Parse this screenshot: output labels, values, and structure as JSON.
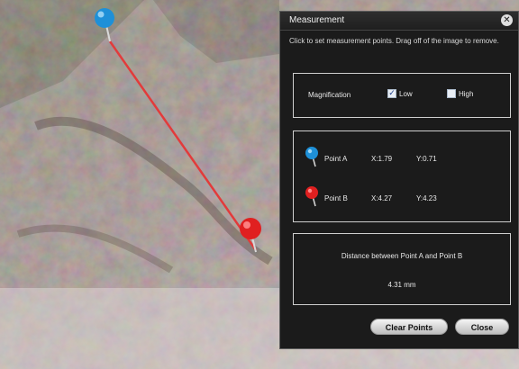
{
  "window": {
    "title": "Measurement",
    "close_glyph": "✕"
  },
  "instructions": "Click to set measurement points. Drag off of the image to remove.",
  "magnification": {
    "label": "Magnification",
    "options": [
      {
        "label": "Low",
        "checked": true
      },
      {
        "label": "High",
        "checked": false
      }
    ]
  },
  "points": [
    {
      "name": "Point A",
      "x": "X:1.79",
      "y": "Y:0.71",
      "icon": "blue-pin-icon",
      "color": "#1e90d8"
    },
    {
      "name": "Point B",
      "x": "X:4.27",
      "y": "Y:4.23",
      "icon": "red-pin-icon",
      "color": "#e02020"
    }
  ],
  "distance": {
    "label": "Distance between Point A and Point B",
    "value": "4.31 mm"
  },
  "buttons": {
    "clear": "Clear Points",
    "close": "Close"
  },
  "colors": {
    "measure_line": "#e23b3b",
    "pin_a": "#1e90d8",
    "pin_b": "#e02020"
  }
}
